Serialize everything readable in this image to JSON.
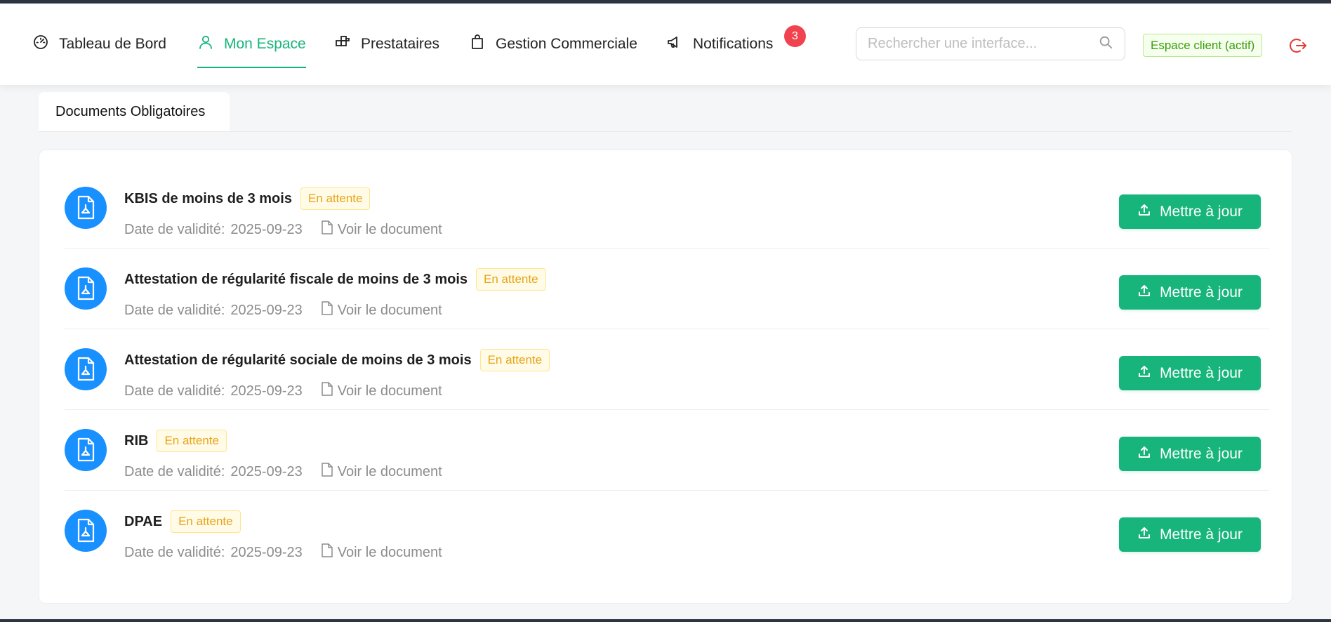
{
  "nav": {
    "items": [
      {
        "label": "Tableau de Bord",
        "icon": "dashboard-icon"
      },
      {
        "label": "Mon Espace",
        "icon": "user-icon",
        "active": true
      },
      {
        "label": "Prestataires",
        "icon": "blocks-icon"
      },
      {
        "label": "Gestion Commerciale",
        "icon": "shopping-bag-icon"
      },
      {
        "label": "Notifications",
        "icon": "megaphone-icon"
      }
    ],
    "notifications_count": "3",
    "search_placeholder": "Rechercher une interface...",
    "client_tag": "Espace client (actif)",
    "logout_icon": "logout-icon"
  },
  "tabs": [
    {
      "label": "Documents Obligatoires",
      "active": true
    }
  ],
  "documents": {
    "date_label": "Date de validité:",
    "view_label": "Voir le document",
    "update_label": "Mettre à jour",
    "items": [
      {
        "title": "KBIS de moins de 3 mois",
        "status": "En attente",
        "date": "2025-09-23"
      },
      {
        "title": "Attestation de régularité fiscale de moins de 3 mois",
        "status": "En attente",
        "date": "2025-09-23"
      },
      {
        "title": "Attestation de régularité sociale de moins de 3 mois",
        "status": "En attente",
        "date": "2025-09-23"
      },
      {
        "title": "RIB",
        "status": "En attente",
        "date": "2025-09-23"
      },
      {
        "title": "DPAE",
        "status": "En attente",
        "date": "2025-09-23"
      }
    ]
  },
  "colors": {
    "accent": "#17b57c",
    "doc_icon_bg": "#1890ff",
    "badge": "#f0434f",
    "status_text": "#e8a317",
    "client_tag": "#389e0d"
  }
}
